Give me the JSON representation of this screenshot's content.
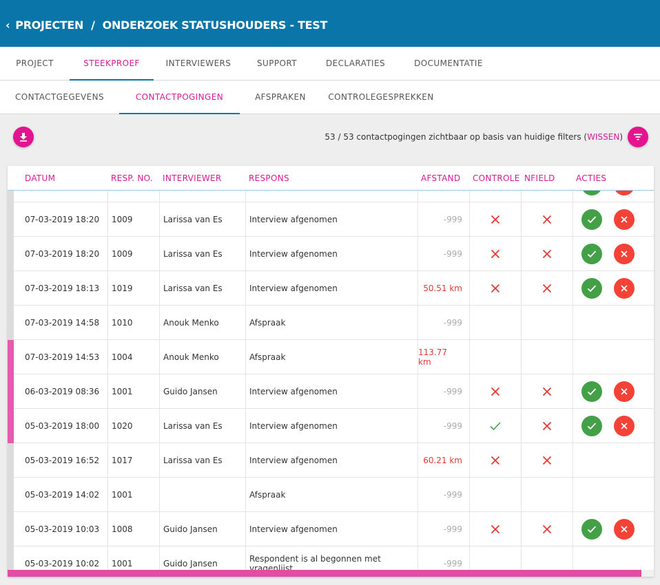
{
  "header": {
    "back_glyph": "‹",
    "crumb_parent": "PROJECTEN",
    "separator": "/",
    "crumb_current": "ONDERZOEK STATUSHOUDERS - TEST",
    "background_color": "#0a75a8"
  },
  "primary_tabs": [
    {
      "label": "PROJECT",
      "active": false
    },
    {
      "label": "STEEKPROEF",
      "active": true
    },
    {
      "label": "INTERVIEWERS",
      "active": false
    },
    {
      "label": "SUPPORT",
      "active": false
    },
    {
      "label": "DECLARATIES",
      "active": false
    },
    {
      "label": "DOCUMENTATIE",
      "active": false
    }
  ],
  "secondary_tabs": [
    {
      "label": "CONTACTGEGEVENS",
      "active": false
    },
    {
      "label": "CONTACTPOGINGEN",
      "active": true
    },
    {
      "label": "AFSPRAKEN",
      "active": false
    },
    {
      "label": "CONTROLEGESPREKKEN",
      "active": false
    }
  ],
  "toolbar": {
    "download_icon": "download-icon",
    "filter_icon": "filter-icon",
    "summary_text": "53 / 53 contactpogingen zichtbaar op basis van huidige filters (",
    "clear_label": "WISSEN",
    "summary_end": ")"
  },
  "table": {
    "columns": {
      "datum": "DATUM",
      "resp_no": "RESP. NO.",
      "interviewer": "INTERVIEWER",
      "respons": "RESPONS",
      "afstand": "AFSTAND",
      "controle": "CONTROLE",
      "nfield": "NFIELD",
      "acties": "ACTIES"
    },
    "rows": [
      {
        "datum": "",
        "resp_no": "",
        "interviewer": "",
        "respons": "",
        "afstand": "",
        "distance_alert": false,
        "controle": "none",
        "nfield": "none",
        "actions": true,
        "marker": "gray"
      },
      {
        "datum": "07-03-2019 18:20",
        "resp_no": "1009",
        "interviewer": "Larissa van Es",
        "respons": "Interview afgenomen",
        "afstand": "-999",
        "distance_alert": false,
        "controle": "fail",
        "nfield": "fail",
        "actions": true,
        "marker": "gray"
      },
      {
        "datum": "07-03-2019 18:20",
        "resp_no": "1009",
        "interviewer": "Larissa van Es",
        "respons": "Interview afgenomen",
        "afstand": "-999",
        "distance_alert": false,
        "controle": "fail",
        "nfield": "fail",
        "actions": true,
        "marker": "gray"
      },
      {
        "datum": "07-03-2019 18:13",
        "resp_no": "1019",
        "interviewer": "Larissa van Es",
        "respons": "Interview afgenomen",
        "afstand": "50.51 km",
        "distance_alert": true,
        "controle": "fail",
        "nfield": "fail",
        "actions": true,
        "marker": "gray"
      },
      {
        "datum": "07-03-2019 14:58",
        "resp_no": "1010",
        "interviewer": "Anouk Menko",
        "respons": "Afspraak",
        "afstand": "-999",
        "distance_alert": false,
        "controle": "none",
        "nfield": "none",
        "actions": false,
        "marker": "gray"
      },
      {
        "datum": "07-03-2019 14:53",
        "resp_no": "1004",
        "interviewer": "Anouk Menko",
        "respons": "Afspraak",
        "afstand": "113.77 km",
        "distance_alert": true,
        "controle": "none",
        "nfield": "none",
        "actions": false,
        "marker": "pink"
      },
      {
        "datum": "06-03-2019 08:36",
        "resp_no": "1001",
        "interviewer": "Guido Jansen",
        "respons": "Interview afgenomen",
        "afstand": "-999",
        "distance_alert": false,
        "controle": "fail",
        "nfield": "fail",
        "actions": true,
        "marker": "pink"
      },
      {
        "datum": "05-03-2019 18:00",
        "resp_no": "1020",
        "interviewer": "Larissa van Es",
        "respons": "Interview afgenomen",
        "afstand": "-999",
        "distance_alert": false,
        "controle": "pass",
        "nfield": "fail",
        "actions": true,
        "marker": "pink"
      },
      {
        "datum": "05-03-2019 16:52",
        "resp_no": "1017",
        "interviewer": "Larissa van Es",
        "respons": "Interview afgenomen",
        "afstand": "60.21 km",
        "distance_alert": true,
        "controle": "fail",
        "nfield": "fail",
        "actions": false,
        "marker": "gray"
      },
      {
        "datum": "05-03-2019 14:02",
        "resp_no": "1001",
        "interviewer": "",
        "respons": "Afspraak",
        "afstand": "-999",
        "distance_alert": false,
        "controle": "none",
        "nfield": "none",
        "actions": false,
        "marker": "gray"
      },
      {
        "datum": "05-03-2019 10:03",
        "resp_no": "1008",
        "interviewer": "Guido Jansen",
        "respons": "Interview afgenomen",
        "afstand": "-999",
        "distance_alert": false,
        "controle": "fail",
        "nfield": "fail",
        "actions": true,
        "marker": "gray"
      },
      {
        "datum": "05-03-2019 10:02",
        "resp_no": "1001",
        "interviewer": "Guido Jansen",
        "respons": "Respondent is al begonnen met vragenlijst",
        "afstand": "-999",
        "distance_alert": false,
        "controle": "none",
        "nfield": "none",
        "actions": false,
        "marker": "gray"
      }
    ]
  },
  "colors": {
    "accent": "#d81b94",
    "fab": "#e3148f",
    "approve": "#43a047",
    "reject": "#f44336",
    "fail_mark": "#e53935",
    "pass_mark": "#43a047"
  }
}
